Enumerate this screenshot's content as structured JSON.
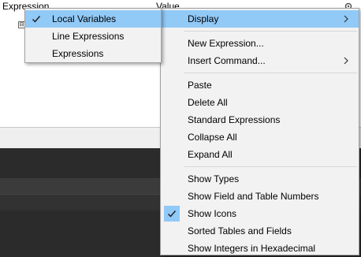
{
  "background": {
    "header": {
      "expression_col": "Expression",
      "value_col": "Value"
    },
    "tree_toggle": "⊟"
  },
  "context_menu": {
    "items": [
      {
        "label": "Display",
        "submenu": true,
        "highlighted": true
      },
      {
        "label": "New Expression..."
      },
      {
        "label": "Insert Command...",
        "submenu": true
      },
      {
        "label": "Paste"
      },
      {
        "label": "Delete All"
      },
      {
        "label": "Standard Expressions"
      },
      {
        "label": "Collapse All"
      },
      {
        "label": "Expand All"
      },
      {
        "label": "Show Types"
      },
      {
        "label": "Show Field and Table Numbers"
      },
      {
        "label": "Show Icons",
        "checked": true
      },
      {
        "label": "Sorted Tables and Fields"
      },
      {
        "label": "Show Integers in Hexadecimal"
      }
    ]
  },
  "display_submenu": {
    "items": [
      {
        "label": "Local Variables",
        "checked": true,
        "highlighted": true
      },
      {
        "label": "Line Expressions"
      },
      {
        "label": "Expressions"
      }
    ]
  },
  "colors": {
    "highlight": "#91c9f7",
    "menu_bg": "#f2f2f2",
    "dark_panel": "#2b2b2b"
  }
}
